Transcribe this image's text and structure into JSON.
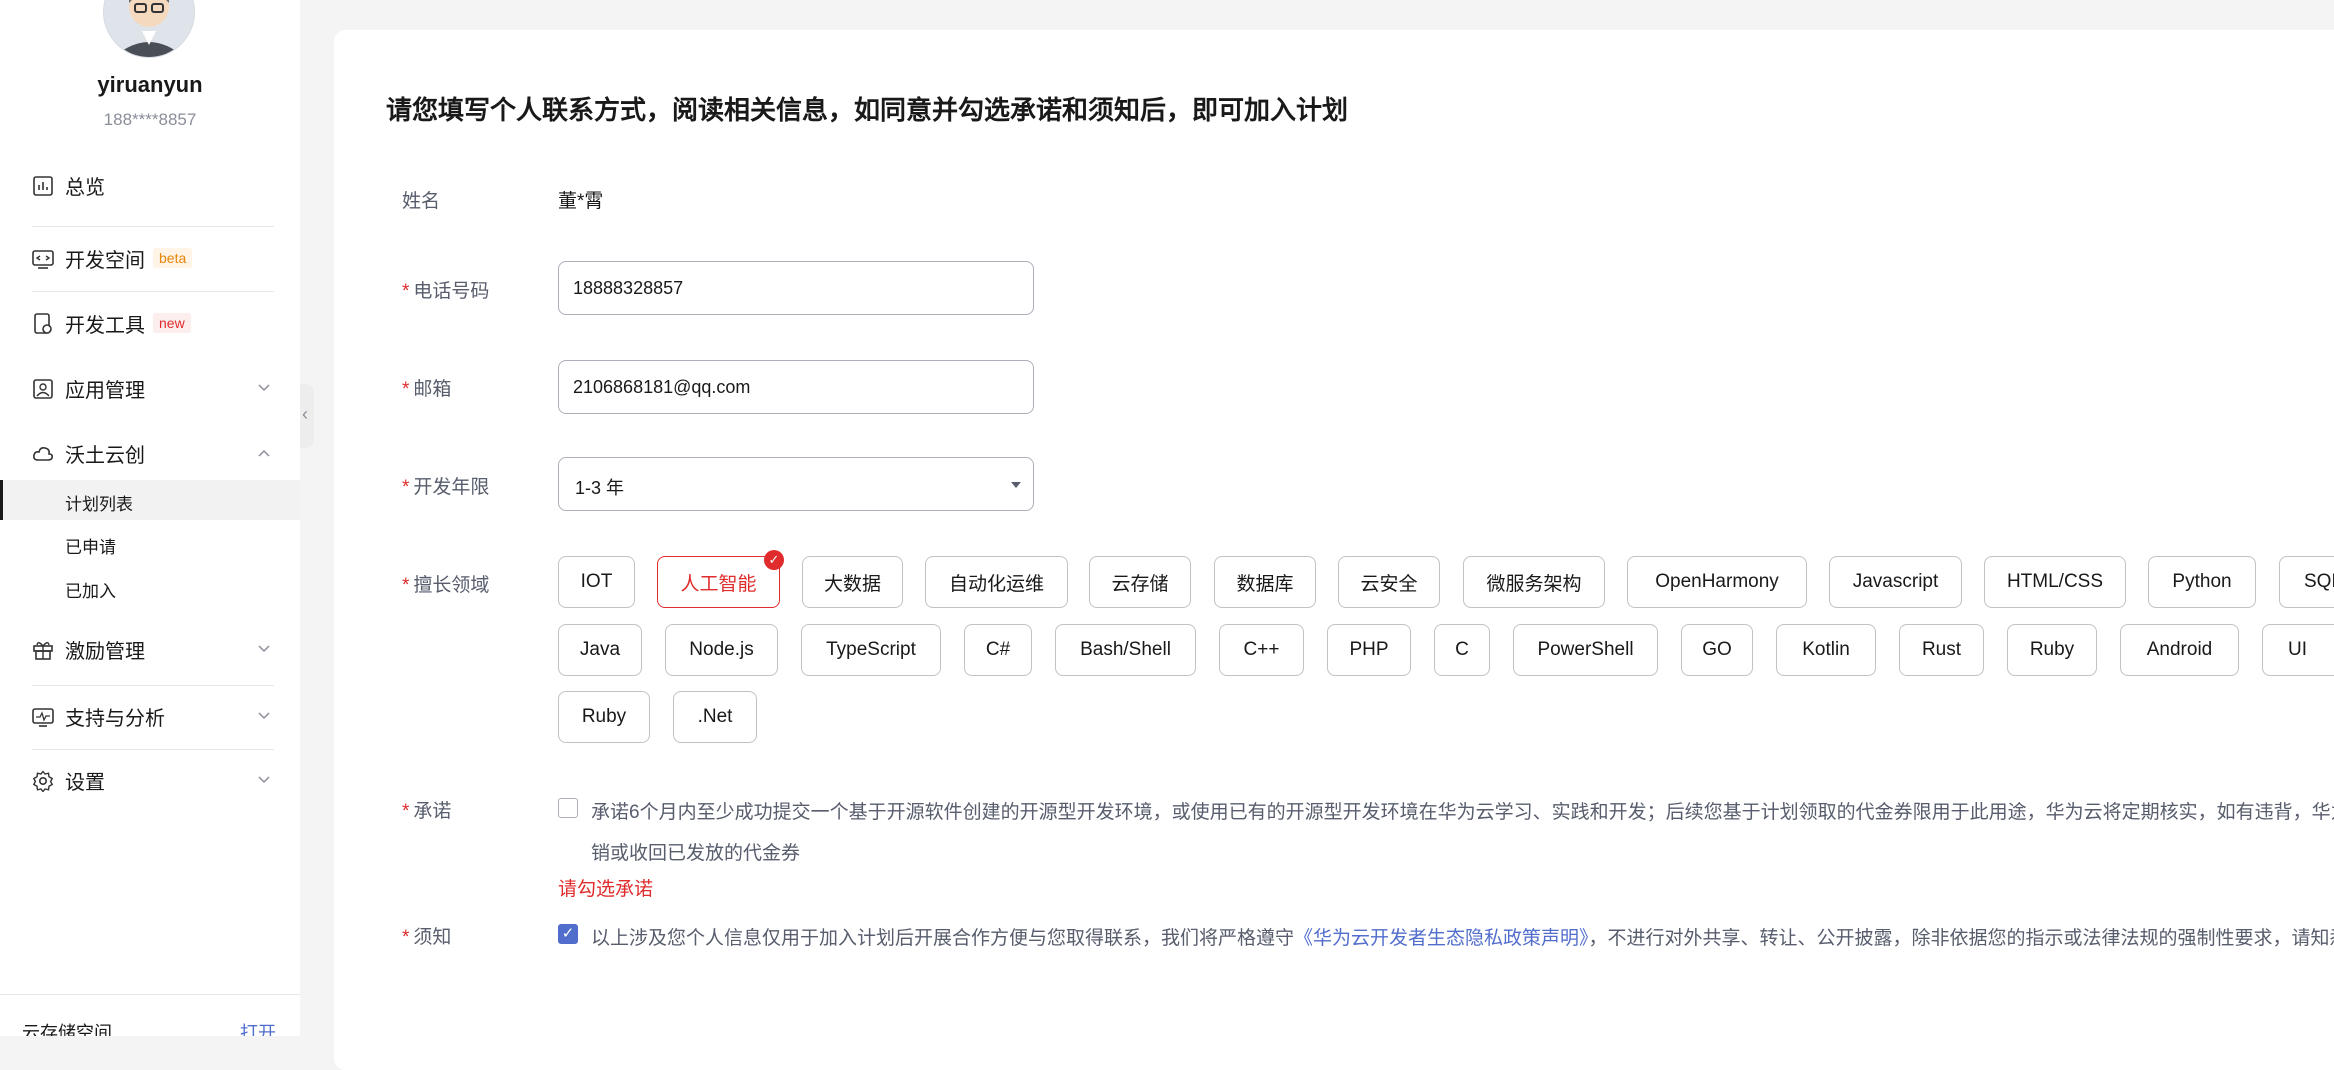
{
  "sidebar": {
    "username": "yiruanyun",
    "phone": "188****8857",
    "nav": [
      {
        "label": "总览",
        "icon": "chart-icon"
      },
      {
        "label": "开发空间",
        "icon": "code-screen-icon",
        "badge": "beta"
      },
      {
        "label": "开发工具",
        "icon": "tool-icon",
        "badge": "new"
      },
      {
        "label": "应用管理",
        "icon": "app-icon"
      },
      {
        "label": "沃土云创",
        "icon": "cloud-icon"
      },
      {
        "label": "激励管理",
        "icon": "gift-icon"
      },
      {
        "label": "支持与分析",
        "icon": "monitor-icon"
      },
      {
        "label": "设置",
        "icon": "gear-icon"
      }
    ],
    "sub_items": [
      "计划列表",
      "已申请",
      "已加入"
    ],
    "bottom": {
      "label": "云存储空间",
      "link": "打开"
    }
  },
  "form": {
    "title": "请您填写个人联系方式，阅读相关信息，如同意并勾选承诺和须知后，即可加入计划",
    "name_label": "姓名",
    "name_value": "董*霄",
    "required_mark": "*",
    "phone_label": "电话号码",
    "phone_value": "18888328857",
    "email_label": "邮箱",
    "email_value": "2106868181@qq.com",
    "years_label": "开发年限",
    "years_value": "1-3 年",
    "skills_label": "擅长领域",
    "skills_row1": [
      "IOT",
      "人工智能",
      "大数据",
      "自动化运维",
      "云存储",
      "数据库",
      "云安全",
      "微服务架构",
      "OpenHarmony",
      "Javascript",
      "HTML/CSS",
      "Python",
      "SQL"
    ],
    "skills_row2": [
      "Java",
      "Node.js",
      "TypeScript",
      "C#",
      "Bash/Shell",
      "C++",
      "PHP",
      "C",
      "PowerShell",
      "GO",
      "Kotlin",
      "Rust",
      "Ruby",
      "Android",
      "UI"
    ],
    "skills_row3": [
      "Ruby",
      ".Net"
    ],
    "selected_skill": "人工智能",
    "promise_label": "承诺",
    "promise_line1": "承诺6个月内至少成功提交一个基于开源软件创建的开源型开发环境，或使用已有的开源型开发环境在华为云学习、实践和开发；后续您基于计划领取的代金券限用于此用途，华为云将定期核实，如有违背，华为云",
    "promise_line2": "销或收回已发放的代金券",
    "promise_error": "请勾选承诺",
    "notice_label": "须知",
    "notice_before": "以上涉及您个人信息仅用于加入计划后开展合作方便与您取得联系，我们将严格遵守",
    "notice_link": "《华为云开发者生态隐私政策声明》",
    "notice_after": "，不进行对外共享、转让、公开披露，除非依据您的指示或法律法规的强制性要求，请知悉"
  },
  "colors": {
    "accent_red": "#e02c2c",
    "link_blue": "#526ecc"
  }
}
